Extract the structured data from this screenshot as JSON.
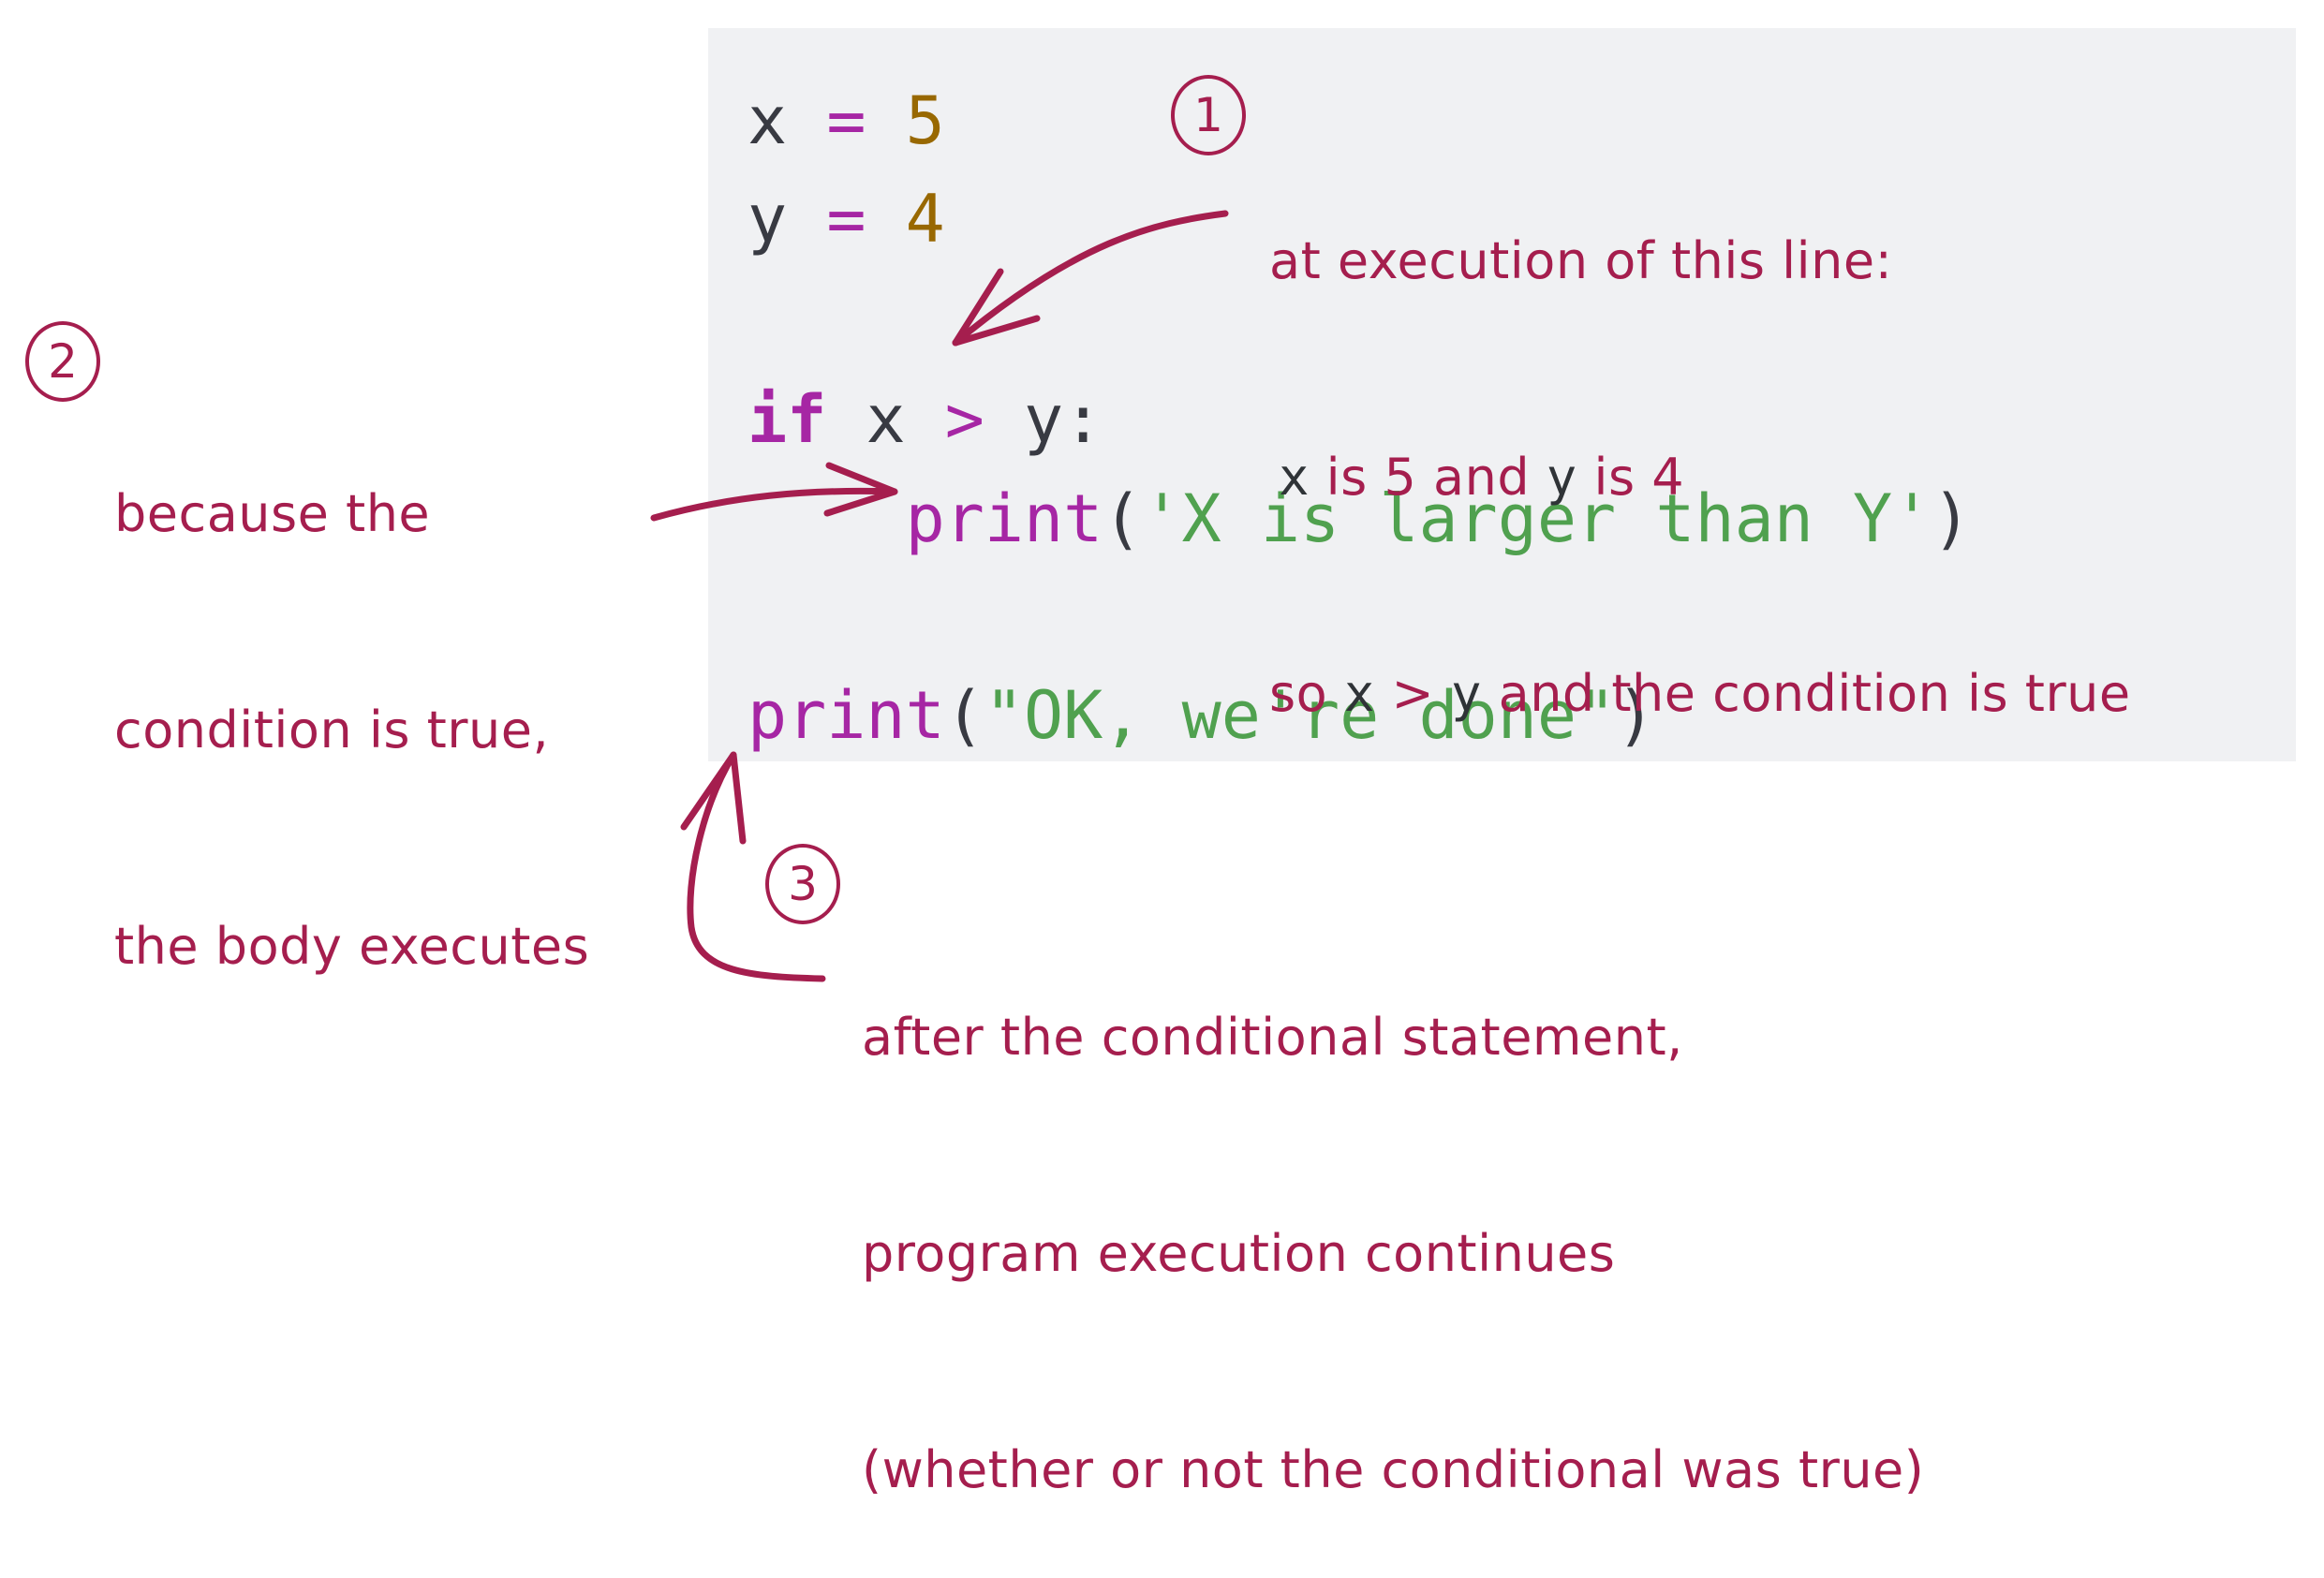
{
  "code": {
    "lines": [
      {
        "tokens": [
          {
            "t": "x",
            "c": "var"
          },
          {
            "t": " ",
            "c": "var"
          },
          {
            "t": "=",
            "c": "op"
          },
          {
            "t": " ",
            "c": "var"
          },
          {
            "t": "5",
            "c": "num"
          }
        ]
      },
      {
        "tokens": [
          {
            "t": "y",
            "c": "var"
          },
          {
            "t": " ",
            "c": "var"
          },
          {
            "t": "=",
            "c": "op"
          },
          {
            "t": " ",
            "c": "var"
          },
          {
            "t": "4",
            "c": "num"
          }
        ]
      },
      {
        "tokens": []
      },
      {
        "tokens": [
          {
            "t": "if",
            "c": "kw"
          },
          {
            "t": " x ",
            "c": "var"
          },
          {
            "t": ">",
            "c": "op"
          },
          {
            "t": " y:",
            "c": "var"
          }
        ]
      },
      {
        "tokens": [
          {
            "t": "    ",
            "c": "var"
          },
          {
            "t": "print",
            "c": "fn"
          },
          {
            "t": "(",
            "c": "punc"
          },
          {
            "t": "'X is larger than Y'",
            "c": "str"
          },
          {
            "t": ")",
            "c": "punc"
          }
        ]
      },
      {
        "tokens": []
      },
      {
        "tokens": [
          {
            "t": "print",
            "c": "fn"
          },
          {
            "t": "(",
            "c": "punc"
          },
          {
            "t": "\"OK, we're done\"",
            "c": "str"
          },
          {
            "t": ")",
            "c": "punc"
          }
        ]
      }
    ]
  },
  "annotations": {
    "note1": {
      "badge": "1",
      "line1": "at execution of this line:",
      "line2": {
        "x": "x",
        "is5": " is 5 and ",
        "y": "y",
        "is4": " is 4"
      },
      "line3": {
        "so": "so ",
        "x": "x",
        "gt": " > ",
        "y": "y",
        "rest": " and the condition is true"
      }
    },
    "note2": {
      "badge": "2",
      "line1": "because the",
      "line2": "condition is true,",
      "line3": "the body executes"
    },
    "note3": {
      "badge": "3",
      "line1": "after the conditional statement,",
      "line2": "program execution continues",
      "line3": "(whether or not the conditional was true)"
    }
  },
  "colors": {
    "annotation": "#A51E4E",
    "code_background": "#F0F1F3",
    "keyword": "#A626A4",
    "string": "#50A14F",
    "number": "#986801",
    "identifier": "#383A42"
  }
}
